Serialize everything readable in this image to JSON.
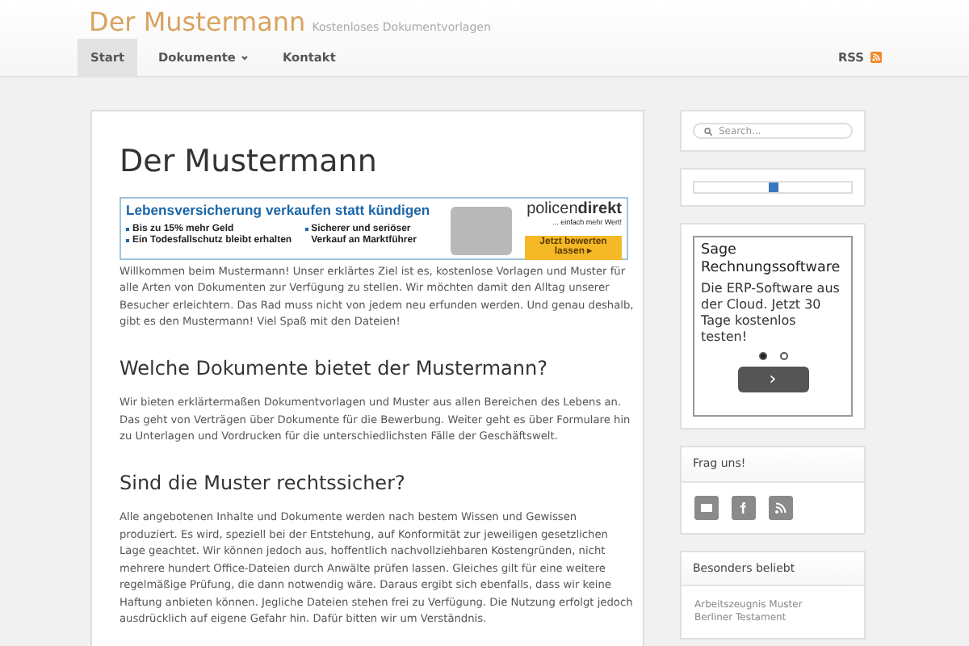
{
  "header": {
    "site_title": "Der Mustermann",
    "tagline": "Kostenloses Dokumentvorlagen"
  },
  "nav": {
    "items": [
      {
        "label": "Start",
        "selected": true,
        "dropdown": false
      },
      {
        "label": "Dokumente",
        "selected": false,
        "dropdown": true
      },
      {
        "label": "Kontakt",
        "selected": false,
        "dropdown": false
      }
    ],
    "rss": "RSS"
  },
  "article": {
    "title": "Der Mustermann",
    "ad": {
      "headline": "Lebensversicherung verkaufen statt kündigen",
      "bullets_left": [
        "Bis zu 15% mehr Geld",
        "Ein Todesfallschutz bleibt erhalten"
      ],
      "bullets_right": [
        "Sicherer und seriöser Verkauf an Marktführer"
      ],
      "brand": "policen**direkt**",
      "brand_slogan": "... einfach mehr Wert!",
      "cta": "Jetzt bewerten lassen ▸"
    },
    "sections": [
      {
        "text": "Willkommen beim Mustermann! Unser erklärtes Ziel ist es, kostenlose Vorlagen und Muster für alle Arten von Dokumenten zur Verfügung zu stellen. Wir möchten damit den Alltag unserer Besucher erleichtern. Das Rad muss nicht von jedem neu erfunden werden. Und genau deshalb, gibt es den Mustermann! Viel Spaß mit den Dateien!"
      },
      {
        "heading": "Welche Dokumente bietet der Mustermann?",
        "text": "Wir bieten erklärtermaßen Dokumentvorlagen und Muster aus allen Bereichen des Lebens an. Das geht von Verträgen über Dokumente für die Bewerbung. Weiter geht es über Formulare hin zu Unterlagen und Vordrucken für die unterschiedlichsten Fälle der Geschäftswelt."
      },
      {
        "heading": "Sind die Muster rechtssicher?",
        "text": "Alle angebotenen Inhalte und Dokumente werden nach bestem Wissen und Gewissen produziert. Es wird, speziell bei der Entstehung, auf Konformität zur jeweiligen gesetzlichen Lage geachtet. Wir können jedoch aus, hoffentlich nachvollziehbaren Kostengründen, nicht mehrere hundert Office-Dateien durch Anwälte prüfen lassen. Gleiches gilt für eine weitere regelmäßige Prüfung, die dann notwendig wäre. Daraus ergibt sich ebenfalls, dass wir keine Haftung anbieten können. Jegliche Dateien stehen frei zu Verfügung. Die Nutzung erfolgt jedoch ausdrücklich auf eigene Gefahr hin. Dafür bitten wir um Verständnis."
      }
    ]
  },
  "sidebar": {
    "search": {
      "placeholder": "Search..."
    },
    "ad": {
      "title": "Sage Rechnungssoftware",
      "text": "Die ERP-Software aus der Cloud. Jetzt 30 Tage kostenlos testen!",
      "dots": [
        {
          "selected": true
        },
        {
          "selected": false
        }
      ],
      "next": "›"
    },
    "contact": {
      "title": "Frag uns!",
      "icons": [
        {
          "kind": "mail"
        },
        {
          "kind": "facebook"
        },
        {
          "kind": "rss"
        }
      ]
    },
    "popular": {
      "title": "Besonders beliebt",
      "links": [
        "Arbeitszeugnis Muster",
        "Berliner Testament"
      ]
    }
  }
}
